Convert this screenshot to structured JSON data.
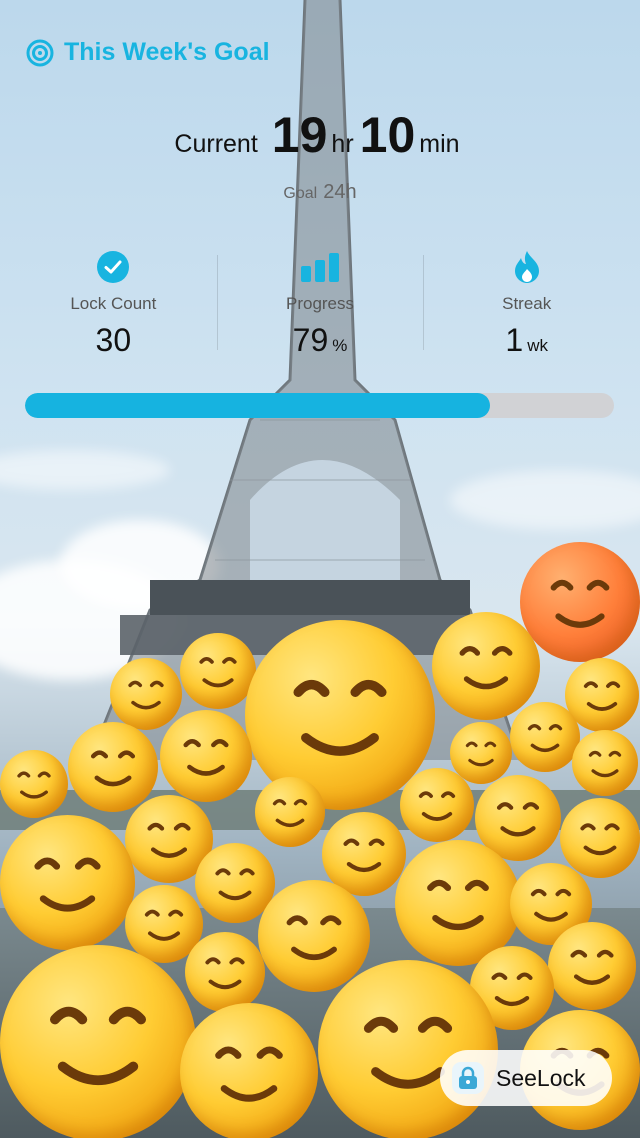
{
  "goal": {
    "title": "This Week's Goal",
    "current_label": "Current",
    "hours": "19",
    "hours_unit": "hr",
    "minutes": "10",
    "minutes_unit": "min",
    "goal_label": "Goal",
    "goal_value": "24h"
  },
  "stats": [
    {
      "name": "Lock Count",
      "value": "30",
      "unit": "",
      "icon": "check-circle-icon"
    },
    {
      "name": "Progress",
      "value": "79",
      "unit": "%",
      "icon": "bar-chart-icon"
    },
    {
      "name": "Streak",
      "value": "1",
      "unit": "wk",
      "icon": "flame-icon"
    }
  ],
  "progress": {
    "percent": 79,
    "color": "#16b3e0",
    "track": "#d1d2d5"
  },
  "brand": {
    "label": "SeeLock",
    "accent": "#18b4e0"
  }
}
